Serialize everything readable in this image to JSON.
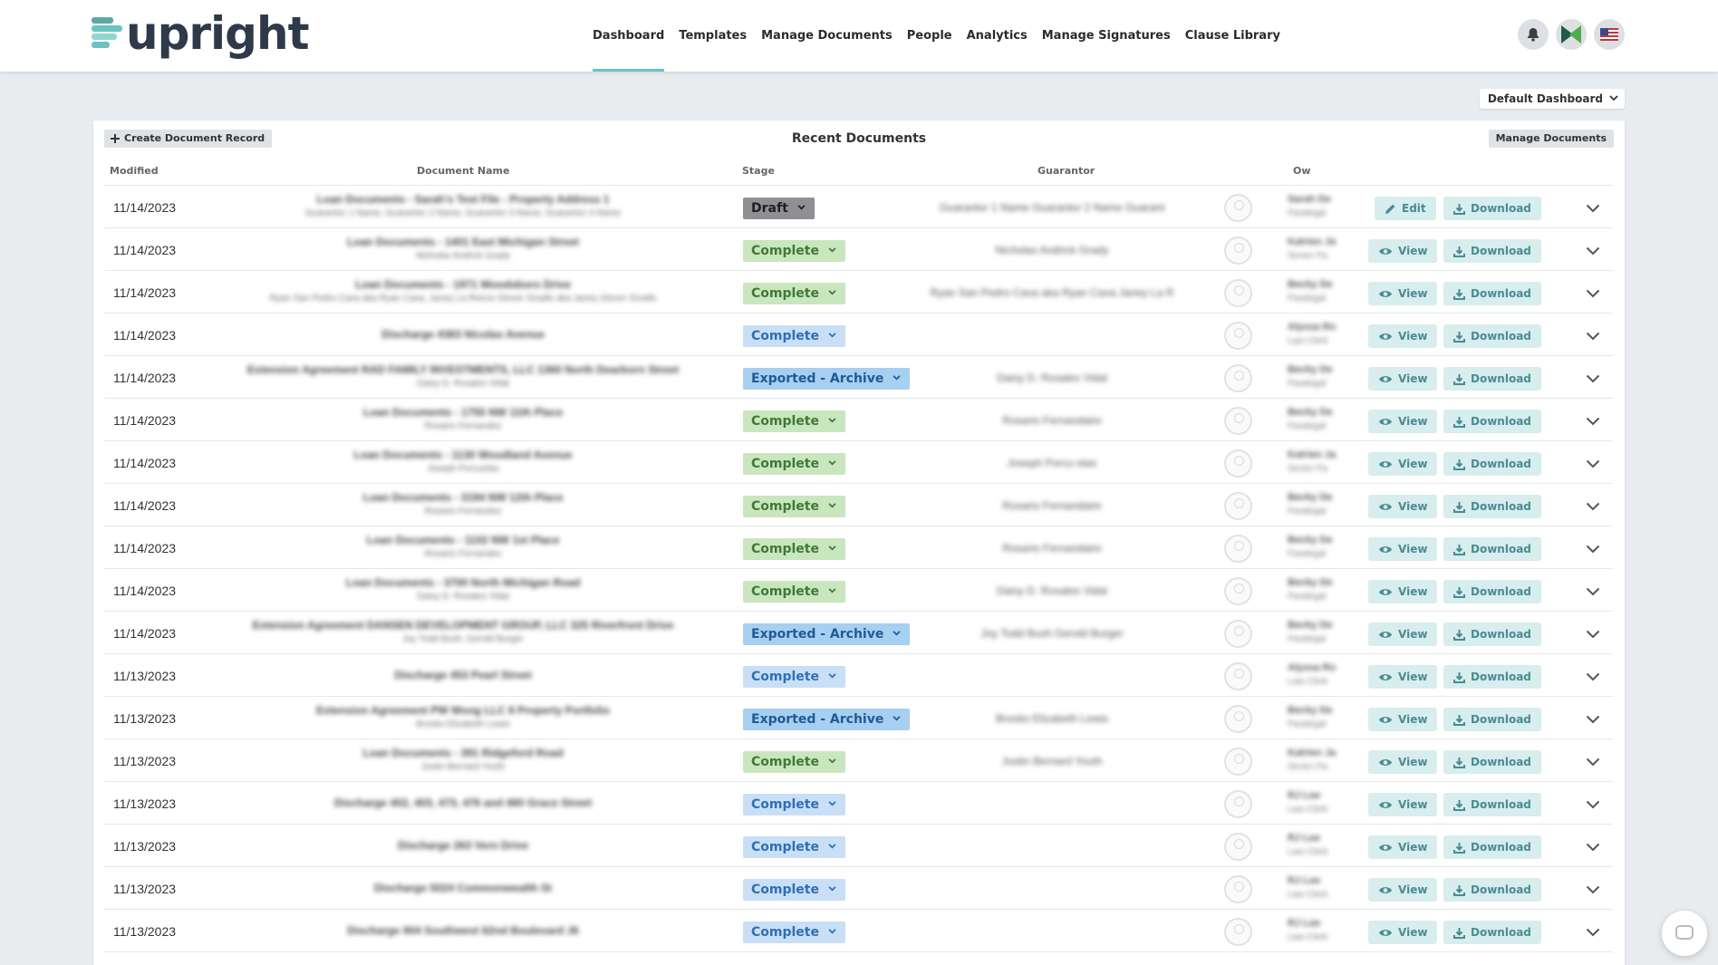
{
  "app": {
    "logo_text": "upright"
  },
  "nav": [
    {
      "label": "Dashboard",
      "active": true
    },
    {
      "label": "Templates"
    },
    {
      "label": "Manage Documents"
    },
    {
      "label": "People"
    },
    {
      "label": "Analytics"
    },
    {
      "label": "Manage Signatures"
    },
    {
      "label": "Clause Library"
    }
  ],
  "top_icons": [
    "bell-icon",
    "profile-logo-icon",
    "us-flag-icon"
  ],
  "dashboard_select": {
    "label": "Default Dashboard"
  },
  "card": {
    "title": "Recent Documents",
    "create_label": "Create Document Record",
    "manage_label": "Manage Documents"
  },
  "columns": {
    "modified": "Modified",
    "document_name": "Document Name",
    "stage": "Stage",
    "guarantor": "Guarantor",
    "owner": "Ow"
  },
  "action_labels": {
    "edit": "Edit",
    "view": "View",
    "download": "Download"
  },
  "colors": {
    "accent": "#6cc3c3",
    "action_text": "#4a8b93",
    "action_bg": "#d7edee",
    "draft": "#8e9094",
    "complete_green": "#c9e6bf",
    "complete_blue": "#c9dff5",
    "archive": "#a7cff0"
  },
  "rows": [
    {
      "modified": "11/14/2023",
      "doc_name": "Loan Documents - Sarah's Test File - Property Address 1",
      "doc_sub": "Guarantor 1 Name, Guarantor 2 Name, Guarantor 3 Name, Guarantor 4 Name",
      "stage": "Draft",
      "stage_style": "draft",
      "guarantor": "Guarantor 1 Name Guarantor 2 Name Guarant",
      "owner_name": "Sarah De",
      "owner_role": "Paralegal",
      "action": "edit"
    },
    {
      "modified": "11/14/2023",
      "doc_name": "Loan Documents - 1401 East Michigan Street",
      "doc_sub": "Nicholas Andrick Grady",
      "stage": "Complete",
      "stage_style": "complete-green",
      "guarantor": "Nicholas Andrick Grady",
      "owner_name": "Katrien Ja",
      "owner_role": "Senior Pa",
      "action": "view"
    },
    {
      "modified": "11/14/2023",
      "doc_name": "Loan Documents - 1971 Woodsboro Drive",
      "doc_sub": "Ryan San Pedro Cava aka Ryan Cava, Janey La Reece Glover Smalls aka Janey Glover Smalls",
      "stage": "Complete",
      "stage_style": "complete-green",
      "guarantor": "Ryan San Pedro Cava aka Ryan Cava Janey La R",
      "owner_name": "Becky De",
      "owner_role": "Paralegal",
      "action": "view"
    },
    {
      "modified": "11/14/2023",
      "doc_name": "Discharge 4383 Nicolas Avenue",
      "doc_sub": "",
      "stage": "Complete",
      "stage_style": "complete-blue",
      "guarantor": "",
      "owner_name": "Alyssa Ro",
      "owner_role": "Law Clerk",
      "action": "view"
    },
    {
      "modified": "11/14/2023",
      "doc_name": "Extension Agreement RAD FAMILY INVESTMENTS, LLC 1360 North Dearborn Street",
      "doc_sub": "Daisy D. Rosales Vidal",
      "stage": "Exported - Archive",
      "stage_style": "archive",
      "guarantor": "Daisy D. Rosales Vidal",
      "owner_name": "Becky De",
      "owner_role": "Paralegal",
      "action": "view"
    },
    {
      "modified": "11/14/2023",
      "doc_name": "Loan Documents - 1755 NW 11th Place",
      "doc_sub": "Rosario Fernandez",
      "stage": "Complete",
      "stage_style": "complete-green",
      "guarantor": "Rosario Fernandaire",
      "owner_name": "Becky De",
      "owner_role": "Paralegal",
      "action": "view"
    },
    {
      "modified": "11/14/2023",
      "doc_name": "Loan Documents - 1130 Woodland Avenue",
      "doc_sub": "Joseph Porcuelas",
      "stage": "Complete",
      "stage_style": "complete-green",
      "guarantor": "Joseph Porcu elas",
      "owner_name": "Katrien Ja",
      "owner_role": "Senior Pa",
      "action": "view"
    },
    {
      "modified": "11/14/2023",
      "doc_name": "Loan Documents - 3194 NW 12th Place",
      "doc_sub": "Rosario Fernandez",
      "stage": "Complete",
      "stage_style": "complete-green",
      "guarantor": "Rosario Fernandaire",
      "owner_name": "Becky De",
      "owner_role": "Paralegal",
      "action": "view"
    },
    {
      "modified": "11/14/2023",
      "doc_name": "Loan Documents - 1102 NW 1st Place",
      "doc_sub": "Rosario Fernandez",
      "stage": "Complete",
      "stage_style": "complete-green",
      "guarantor": "Rosario Fernandaire",
      "owner_name": "Becky De",
      "owner_role": "Paralegal",
      "action": "view"
    },
    {
      "modified": "11/14/2023",
      "doc_name": "Loan Documents - 3700 North Michigan Road",
      "doc_sub": "Daisy D. Rosales Vidal",
      "stage": "Complete",
      "stage_style": "complete-green",
      "guarantor": "Daisy D. Rosales Vidal",
      "owner_name": "Becky De",
      "owner_role": "Paralegal",
      "action": "view"
    },
    {
      "modified": "11/14/2023",
      "doc_name": "Extension Agreement DANSEN DEVELOPMENT GROUP, LLC 325 Riverfront Drive",
      "doc_sub": "Joy Todd Bush, Gerold Burger",
      "stage": "Exported - Archive",
      "stage_style": "archive",
      "guarantor": "Joy Todd Bush Gerold Burger",
      "owner_name": "Becky De",
      "owner_role": "Paralegal",
      "action": "view"
    },
    {
      "modified": "11/13/2023",
      "doc_name": "Discharge 453 Pearl Street",
      "doc_sub": "",
      "stage": "Complete",
      "stage_style": "complete-blue",
      "guarantor": "",
      "owner_name": "Alyssa Ro",
      "owner_role": "Law Clerk",
      "action": "view"
    },
    {
      "modified": "11/13/2023",
      "doc_name": "Extension Agreement PW Wong LLC 8 Property Portfolio",
      "doc_sub": "Brooks Elizabeth Lewis",
      "stage": "Exported - Archive",
      "stage_style": "archive",
      "guarantor": "Brooks Elizabeth Lewis",
      "owner_name": "Becky De",
      "owner_role": "Paralegal",
      "action": "view"
    },
    {
      "modified": "11/13/2023",
      "doc_name": "Loan Documents - 391 Ridgeford Road",
      "doc_sub": "Justin Bernard Youth",
      "stage": "Complete",
      "stage_style": "complete-green",
      "guarantor": "Justin Bernard Youth",
      "owner_name": "Katrien Ja",
      "owner_role": "Senior Pa",
      "action": "view"
    },
    {
      "modified": "11/13/2023",
      "doc_name": "Discharge 402, 403, 473, 476 and 480 Grace Street",
      "doc_sub": "",
      "stage": "Complete",
      "stage_style": "complete-blue",
      "guarantor": "",
      "owner_name": "RJ Lee",
      "owner_role": "Law Clerk",
      "action": "view"
    },
    {
      "modified": "11/13/2023",
      "doc_name": "Discharge 263 Vern Drive",
      "doc_sub": "",
      "stage": "Complete",
      "stage_style": "complete-blue",
      "guarantor": "",
      "owner_name": "RJ Lee",
      "owner_role": "Law Clerk",
      "action": "view"
    },
    {
      "modified": "11/13/2023",
      "doc_name": "Discharge 5024 Commonwealth St",
      "doc_sub": "",
      "stage": "Complete",
      "stage_style": "complete-blue",
      "guarantor": "",
      "owner_name": "RJ Lee",
      "owner_role": "Law Clerk",
      "action": "view"
    },
    {
      "modified": "11/13/2023",
      "doc_name": "Discharge 904 Southwest 62nd Boulevard J6",
      "doc_sub": "",
      "stage": "Complete",
      "stage_style": "complete-blue",
      "guarantor": "",
      "owner_name": "RJ Lee",
      "owner_role": "Law Clerk",
      "action": "view"
    }
  ]
}
